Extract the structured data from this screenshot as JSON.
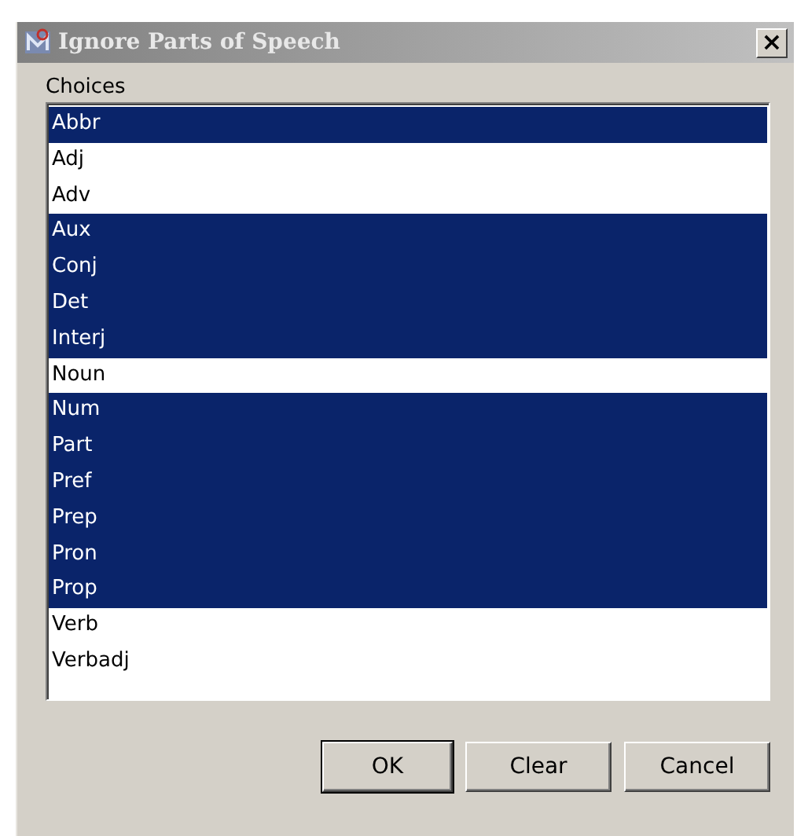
{
  "window": {
    "title": "Ignore Parts of Speech",
    "close": "×"
  },
  "choices": {
    "label": "Choices",
    "items": [
      {
        "label": "Abbr",
        "selected": true
      },
      {
        "label": "Adj",
        "selected": false
      },
      {
        "label": "Adv",
        "selected": false
      },
      {
        "label": "Aux",
        "selected": true
      },
      {
        "label": "Conj",
        "selected": true
      },
      {
        "label": "Det",
        "selected": true
      },
      {
        "label": "Interj",
        "selected": true
      },
      {
        "label": "Noun",
        "selected": false
      },
      {
        "label": "Num",
        "selected": true
      },
      {
        "label": "Part",
        "selected": true
      },
      {
        "label": "Pref",
        "selected": true
      },
      {
        "label": "Prep",
        "selected": true
      },
      {
        "label": "Pron",
        "selected": true
      },
      {
        "label": "Prop",
        "selected": true
      },
      {
        "label": "Verb",
        "selected": false
      },
      {
        "label": "Verbadj",
        "selected": false
      }
    ]
  },
  "buttons": [
    {
      "label": "OK",
      "default": true
    },
    {
      "label": "Clear",
      "default": false
    },
    {
      "label": "Cancel",
      "default": false
    }
  ]
}
